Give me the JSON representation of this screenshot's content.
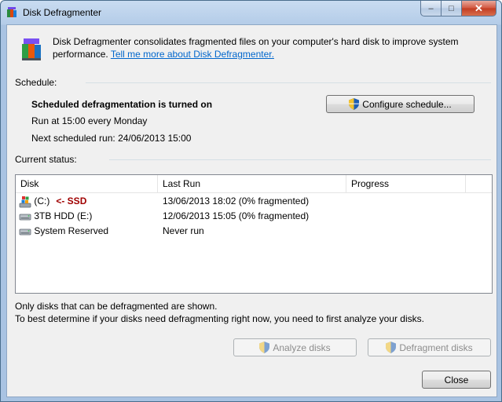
{
  "window": {
    "title": "Disk Defragmenter",
    "controls": {
      "minimize": "–",
      "maximize": "□",
      "close": "✕"
    }
  },
  "header": {
    "description": "Disk Defragmenter consolidates fragmented files on your computer's hard disk to improve system performance.",
    "link": "Tell me more about Disk Defragmenter."
  },
  "schedule": {
    "label": "Schedule:",
    "status": "Scheduled defragmentation is turned on",
    "run_at": "Run at 15:00 every Monday",
    "next_run": "Next scheduled run: 24/06/2013 15:00",
    "configure_button": "Configure schedule..."
  },
  "current_status": {
    "label": "Current status:",
    "columns": {
      "disk": "Disk",
      "last_run": "Last Run",
      "progress": "Progress"
    },
    "rows": [
      {
        "disk": "(C:)",
        "annotation": "<- SSD",
        "last_run": "13/06/2013 18:02 (0% fragmented)",
        "progress": "",
        "icon": "windows-drive-icon"
      },
      {
        "disk": "3TB HDD (E:)",
        "last_run": "12/06/2013 15:05 (0% fragmented)",
        "progress": "",
        "icon": "hard-drive-icon"
      },
      {
        "disk": "System Reserved",
        "last_run": "Never run",
        "progress": "",
        "icon": "hard-drive-icon"
      }
    ]
  },
  "footer": {
    "note1": "Only disks that can be defragmented are shown.",
    "note2": "To best determine if your disks need defragmenting right now, you need to first analyze your disks.",
    "analyze_button": "Analyze disks",
    "defragment_button": "Defragment disks",
    "close_button": "Close"
  }
}
